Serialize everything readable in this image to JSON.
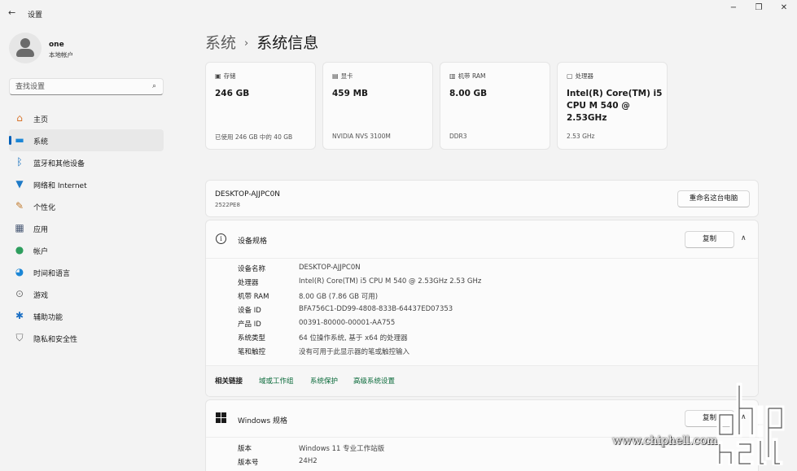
{
  "window": {
    "title": "设置",
    "back_icon": "←",
    "minimize_icon": "−",
    "maximize_icon": "❐",
    "close_icon": "✕"
  },
  "user": {
    "name": "one",
    "account_type": "本地帐户"
  },
  "search": {
    "placeholder": "查找设置",
    "icon": "⌕"
  },
  "nav": {
    "items": [
      {
        "label": "主页",
        "icon": "home-icon",
        "glyph": "⌂",
        "color": "#d8732a",
        "active": false
      },
      {
        "label": "系统",
        "icon": "monitor-icon",
        "glyph": "▬",
        "color": "#1b86d6",
        "active": true
      },
      {
        "label": "蓝牙和其他设备",
        "icon": "bluetooth-icon",
        "glyph": "ᛒ",
        "color": "#0f6cbd",
        "active": false
      },
      {
        "label": "网络和 Internet",
        "icon": "wifi-icon",
        "glyph": "▼",
        "color": "#1e7ac7",
        "active": false
      },
      {
        "label": "个性化",
        "icon": "brush-icon",
        "glyph": "✎",
        "color": "#c07a2c",
        "active": false
      },
      {
        "label": "应用",
        "icon": "apps-icon",
        "glyph": "▦",
        "color": "#4a5a75",
        "active": false
      },
      {
        "label": "帐户",
        "icon": "person-icon",
        "glyph": "●",
        "color": "#2e9e5e",
        "active": false
      },
      {
        "label": "时间和语言",
        "icon": "globe-clock-icon",
        "glyph": "◕",
        "color": "#1b86d6",
        "active": false
      },
      {
        "label": "游戏",
        "icon": "gamepad-icon",
        "glyph": "⊙",
        "color": "#707070",
        "active": false
      },
      {
        "label": "辅助功能",
        "icon": "accessibility-icon",
        "glyph": "✱",
        "color": "#1b6fc4",
        "active": false
      },
      {
        "label": "隐私和安全性",
        "icon": "shield-icon",
        "glyph": "⛉",
        "color": "#6b6b6b",
        "active": false
      }
    ]
  },
  "breadcrumb": {
    "parent": "系统",
    "separator": "›",
    "current": "系统信息"
  },
  "cards": [
    {
      "icon": "storage-icon",
      "glyph": "▣",
      "label": "存储",
      "value": "246 GB",
      "sub": "已使用 246 GB 中的 40 GB"
    },
    {
      "icon": "gpu-icon",
      "glyph": "▤",
      "label": "显卡",
      "value": "459 MB",
      "sub": "NVIDIA NVS 3100M"
    },
    {
      "icon": "ram-icon",
      "glyph": "▥",
      "label": "机带 RAM",
      "value": "8.00 GB",
      "sub": "DDR3"
    },
    {
      "icon": "cpu-icon",
      "glyph": "▢",
      "label": "处理器",
      "value": "Intel(R) Core(TM) i5 CPU      M 540  @ 2.53GHz",
      "sub": "2.53 GHz"
    }
  ],
  "device": {
    "name": "DESKTOP-AJJPC0N",
    "model": "2522PE8",
    "rename_label": "重命名这台电脑"
  },
  "device_specs": {
    "title": "设备规格",
    "info_icon": "i",
    "copy_label": "复制",
    "chevron": "∧",
    "rows": [
      {
        "key": "设备名称",
        "value": "DESKTOP-AJJPC0N"
      },
      {
        "key": "处理器",
        "value": "Intel(R) Core(TM) i5 CPU      M 540  @ 2.53GHz   2.53 GHz"
      },
      {
        "key": "机带 RAM",
        "value": "8.00 GB (7.86 GB 可用)"
      },
      {
        "key": "设备 ID",
        "value": "BFA756C1-DD99-4808-833B-64437ED07353"
      },
      {
        "key": "产品 ID",
        "value": "00391-80000-00001-AA755"
      },
      {
        "key": "系统类型",
        "value": "64 位操作系统, 基于 x64 的处理器"
      },
      {
        "key": "笔和触控",
        "value": "没有可用于此显示器的笔或触控输入"
      }
    ],
    "related_label": "相关链接",
    "related_links": [
      "域或工作组",
      "系统保护",
      "高级系统设置"
    ]
  },
  "windows_specs": {
    "title": "Windows 规格",
    "copy_label": "复制",
    "chevron": "∧",
    "rows": [
      {
        "key": "版本",
        "value": "Windows 11 专业工作站版"
      },
      {
        "key": "版本号",
        "value": "24H2"
      }
    ]
  },
  "watermark": {
    "url_text": "www.chiphell.com"
  }
}
